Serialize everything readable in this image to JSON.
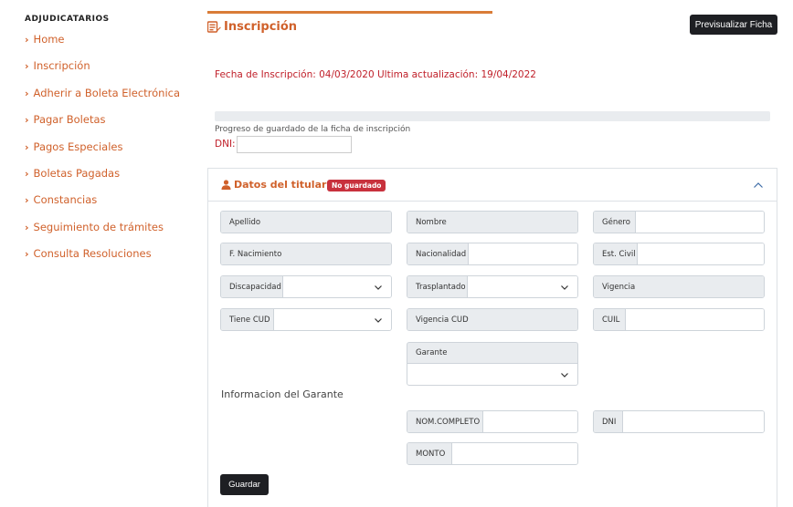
{
  "sidebar": {
    "title": "ADJUDICATARIOS",
    "items": [
      {
        "label": "Home"
      },
      {
        "label": "Inscripción"
      },
      {
        "label": "Adherir a Boleta Electrónica"
      },
      {
        "label": "Pagar Boletas"
      },
      {
        "label": "Pagos Especiales"
      },
      {
        "label": "Boletas Pagadas"
      },
      {
        "label": "Constancias"
      },
      {
        "label": "Seguimiento de trámites"
      },
      {
        "label": "Consulta Resoluciones"
      }
    ]
  },
  "header": {
    "title": "Inscripción",
    "preview_label": "Previsualizar Ficha"
  },
  "dates_text": "Fecha de Inscripción: 04/03/2020 Ultima actualización: 19/04/2022",
  "progress": {
    "label": "Progreso de guardado de la ficha de inscripción",
    "value_percent": 0
  },
  "dni_top": {
    "label": "DNI:",
    "value": ""
  },
  "card": {
    "title": "Datos del titular",
    "badge": "No guardado",
    "fields": {
      "apellido": {
        "label": "Apellido",
        "value": ""
      },
      "nombre": {
        "label": "Nombre",
        "value": ""
      },
      "genero": {
        "label": "Género",
        "value": ""
      },
      "nacimiento": {
        "label": "F. Nacimiento",
        "value": ""
      },
      "nacionalidad": {
        "label": "Nacionalidad",
        "value": ""
      },
      "estcivil": {
        "label": "Est. Civil",
        "value": ""
      },
      "discapacidad": {
        "label": "Discapacidad",
        "value": ""
      },
      "trasplantado": {
        "label": "Trasplantado",
        "value": ""
      },
      "vigencia": {
        "label": "Vigencia",
        "value": ""
      },
      "cud": {
        "label": "Tiene CUD",
        "value": ""
      },
      "vigcud": {
        "label": "Vigencia CUD",
        "value": ""
      },
      "cuil": {
        "label": "CUIL",
        "value": ""
      },
      "garante": {
        "label": "Garante",
        "value": ""
      },
      "nomcompleto": {
        "label": "NOM.COMPLETO",
        "value": ""
      },
      "dni": {
        "label": "DNI",
        "value": ""
      },
      "monto": {
        "label": "MONTO",
        "value": ""
      }
    },
    "garante_section_title": "Informacion del Garante",
    "save_label": "Guardar"
  },
  "colors": {
    "accent": "#d0612b",
    "error_text": "#c0202a",
    "badge_bg": "#c8313d",
    "dark_button": "#1e1f23"
  }
}
